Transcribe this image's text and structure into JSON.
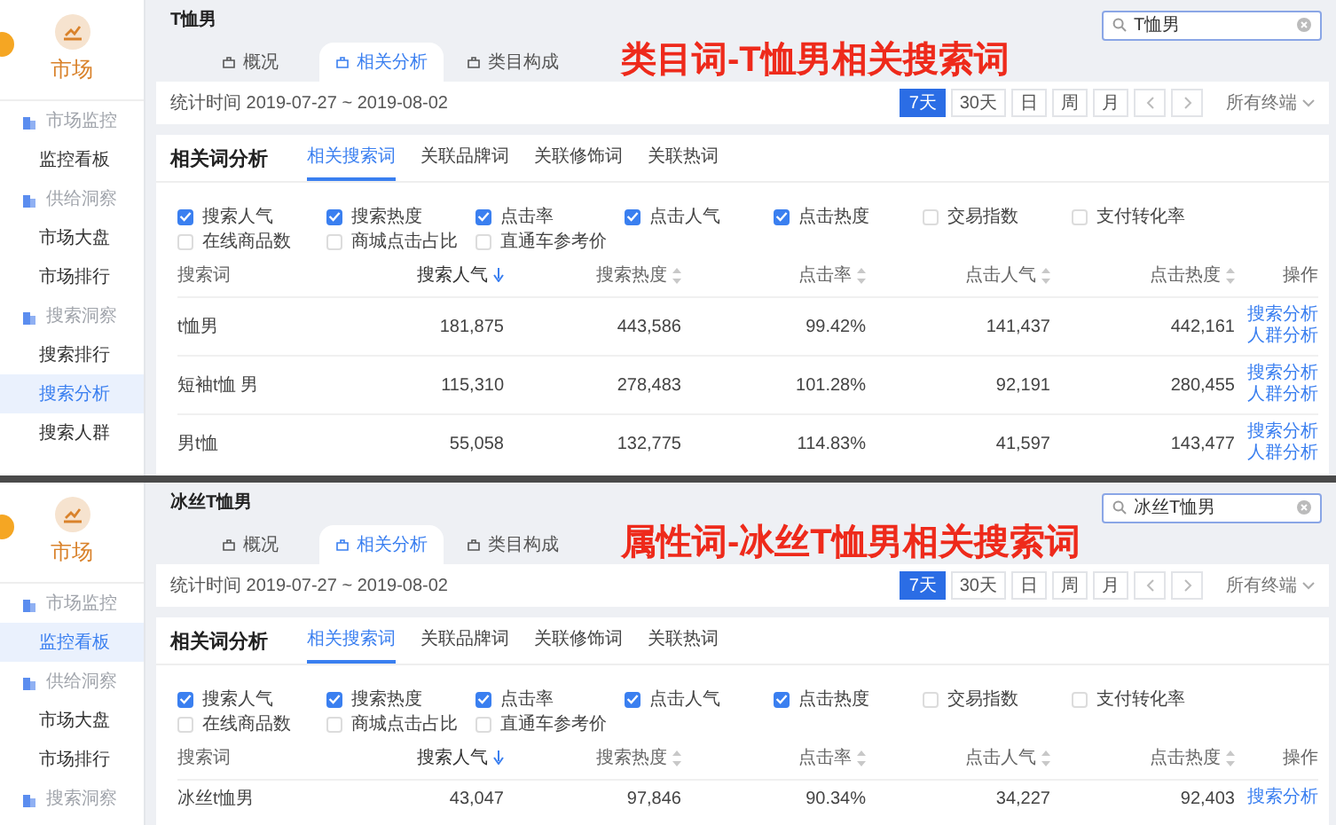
{
  "panels": [
    {
      "sidebar": {
        "logo_label": "市场",
        "groups": [
          {
            "title": "市场监控",
            "items": [
              {
                "label": "监控看板",
                "selected": false
              }
            ]
          },
          {
            "title": "供给洞察",
            "items": [
              {
                "label": "市场大盘",
                "selected": false
              },
              {
                "label": "市场排行",
                "selected": false
              }
            ]
          },
          {
            "title": "搜索洞察",
            "items": [
              {
                "label": "搜索排行",
                "selected": false
              },
              {
                "label": "搜索分析",
                "selected": true
              },
              {
                "label": "搜索人群",
                "selected": false
              }
            ]
          }
        ]
      },
      "page_title": "T恤男",
      "caption": "类目词-T恤男相关搜索词",
      "search": {
        "value": "T恤男"
      },
      "tabs": [
        {
          "label": "概况",
          "selected": false
        },
        {
          "label": "相关分析",
          "selected": true
        },
        {
          "label": "类目构成",
          "selected": false
        }
      ],
      "date_range": "统计时间 2019-07-27 ~ 2019-08-02",
      "ranges": [
        {
          "label": "7天",
          "selected": true
        },
        {
          "label": "30天",
          "selected": false
        },
        {
          "label": "日",
          "selected": false
        },
        {
          "label": "周",
          "selected": false
        },
        {
          "label": "月",
          "selected": false
        }
      ],
      "terminal": "所有终端",
      "card_title": "相关词分析",
      "card_tabs": [
        {
          "label": "相关搜索词",
          "selected": true
        },
        {
          "label": "关联品牌词",
          "selected": false
        },
        {
          "label": "关联修饰词",
          "selected": false
        },
        {
          "label": "关联热词",
          "selected": false
        }
      ],
      "metrics": [
        {
          "label": "搜索人气",
          "checked": true
        },
        {
          "label": "搜索热度",
          "checked": true
        },
        {
          "label": "点击率",
          "checked": true
        },
        {
          "label": "点击人气",
          "checked": true
        },
        {
          "label": "点击热度",
          "checked": true
        },
        {
          "label": "交易指数",
          "checked": false
        },
        {
          "label": "支付转化率",
          "checked": false
        },
        {
          "label": "在线商品数",
          "checked": false
        },
        {
          "label": "商城点击占比",
          "checked": false
        },
        {
          "label": "直通车参考价",
          "checked": false
        }
      ],
      "columns": [
        {
          "label": "搜索词",
          "sortable": false,
          "sorted": false
        },
        {
          "label": "搜索人气",
          "sortable": true,
          "sorted": true
        },
        {
          "label": "搜索热度",
          "sortable": true,
          "sorted": false
        },
        {
          "label": "点击率",
          "sortable": true,
          "sorted": false
        },
        {
          "label": "点击人气",
          "sortable": true,
          "sorted": false
        },
        {
          "label": "点击热度",
          "sortable": true,
          "sorted": false
        },
        {
          "label": "操作",
          "sortable": false,
          "sorted": false
        }
      ],
      "rows": [
        {
          "cells": [
            "t恤男",
            "181,875",
            "443,586",
            "99.42%",
            "141,437",
            "442,161"
          ],
          "actions": [
            "搜索分析",
            "人群分析"
          ]
        },
        {
          "cells": [
            "短袖t恤 男",
            "115,310",
            "278,483",
            "101.28%",
            "92,191",
            "280,455"
          ],
          "actions": [
            "搜索分析",
            "人群分析"
          ]
        },
        {
          "cells": [
            "男t恤",
            "55,058",
            "132,775",
            "114.83%",
            "41,597",
            "143,477"
          ],
          "actions": [
            "搜索分析",
            "人群分析"
          ]
        }
      ]
    },
    {
      "sidebar": {
        "logo_label": "市场",
        "groups": [
          {
            "title": "市场监控",
            "items": [
              {
                "label": "监控看板",
                "selected": true
              }
            ]
          },
          {
            "title": "供给洞察",
            "items": [
              {
                "label": "市场大盘",
                "selected": false
              },
              {
                "label": "市场排行",
                "selected": false
              }
            ]
          },
          {
            "title": "搜索洞察"
          }
        ]
      },
      "page_title": "冰丝T恤男",
      "caption": "属性词-冰丝T恤男相关搜索词",
      "search": {
        "value": "冰丝T恤男"
      },
      "tabs": [
        {
          "label": "概况",
          "selected": false
        },
        {
          "label": "相关分析",
          "selected": true
        },
        {
          "label": "类目构成",
          "selected": false
        }
      ],
      "date_range": "统计时间 2019-07-27 ~ 2019-08-02",
      "ranges": [
        {
          "label": "7天",
          "selected": true
        },
        {
          "label": "30天",
          "selected": false
        },
        {
          "label": "日",
          "selected": false
        },
        {
          "label": "周",
          "selected": false
        },
        {
          "label": "月",
          "selected": false
        }
      ],
      "terminal": "所有终端",
      "card_title": "相关词分析",
      "card_tabs": [
        {
          "label": "相关搜索词",
          "selected": true
        },
        {
          "label": "关联品牌词",
          "selected": false
        },
        {
          "label": "关联修饰词",
          "selected": false
        },
        {
          "label": "关联热词",
          "selected": false
        }
      ],
      "metrics": [
        {
          "label": "搜索人气",
          "checked": true
        },
        {
          "label": "搜索热度",
          "checked": true
        },
        {
          "label": "点击率",
          "checked": true
        },
        {
          "label": "点击人气",
          "checked": true
        },
        {
          "label": "点击热度",
          "checked": true
        },
        {
          "label": "交易指数",
          "checked": false
        },
        {
          "label": "支付转化率",
          "checked": false
        },
        {
          "label": "在线商品数",
          "checked": false
        },
        {
          "label": "商城点击占比",
          "checked": false
        },
        {
          "label": "直通车参考价",
          "checked": false
        }
      ],
      "columns": [
        {
          "label": "搜索词",
          "sortable": false,
          "sorted": false
        },
        {
          "label": "搜索人气",
          "sortable": true,
          "sorted": true
        },
        {
          "label": "搜索热度",
          "sortable": true,
          "sorted": false
        },
        {
          "label": "点击率",
          "sortable": true,
          "sorted": false
        },
        {
          "label": "点击人气",
          "sortable": true,
          "sorted": false
        },
        {
          "label": "点击热度",
          "sortable": true,
          "sorted": false
        },
        {
          "label": "操作",
          "sortable": false,
          "sorted": false
        }
      ],
      "rows": [
        {
          "cells": [
            "冰丝t恤男",
            "43,047",
            "97,846",
            "90.34%",
            "34,227",
            "92,403"
          ],
          "actions": [
            "搜索分析"
          ]
        }
      ]
    }
  ]
}
